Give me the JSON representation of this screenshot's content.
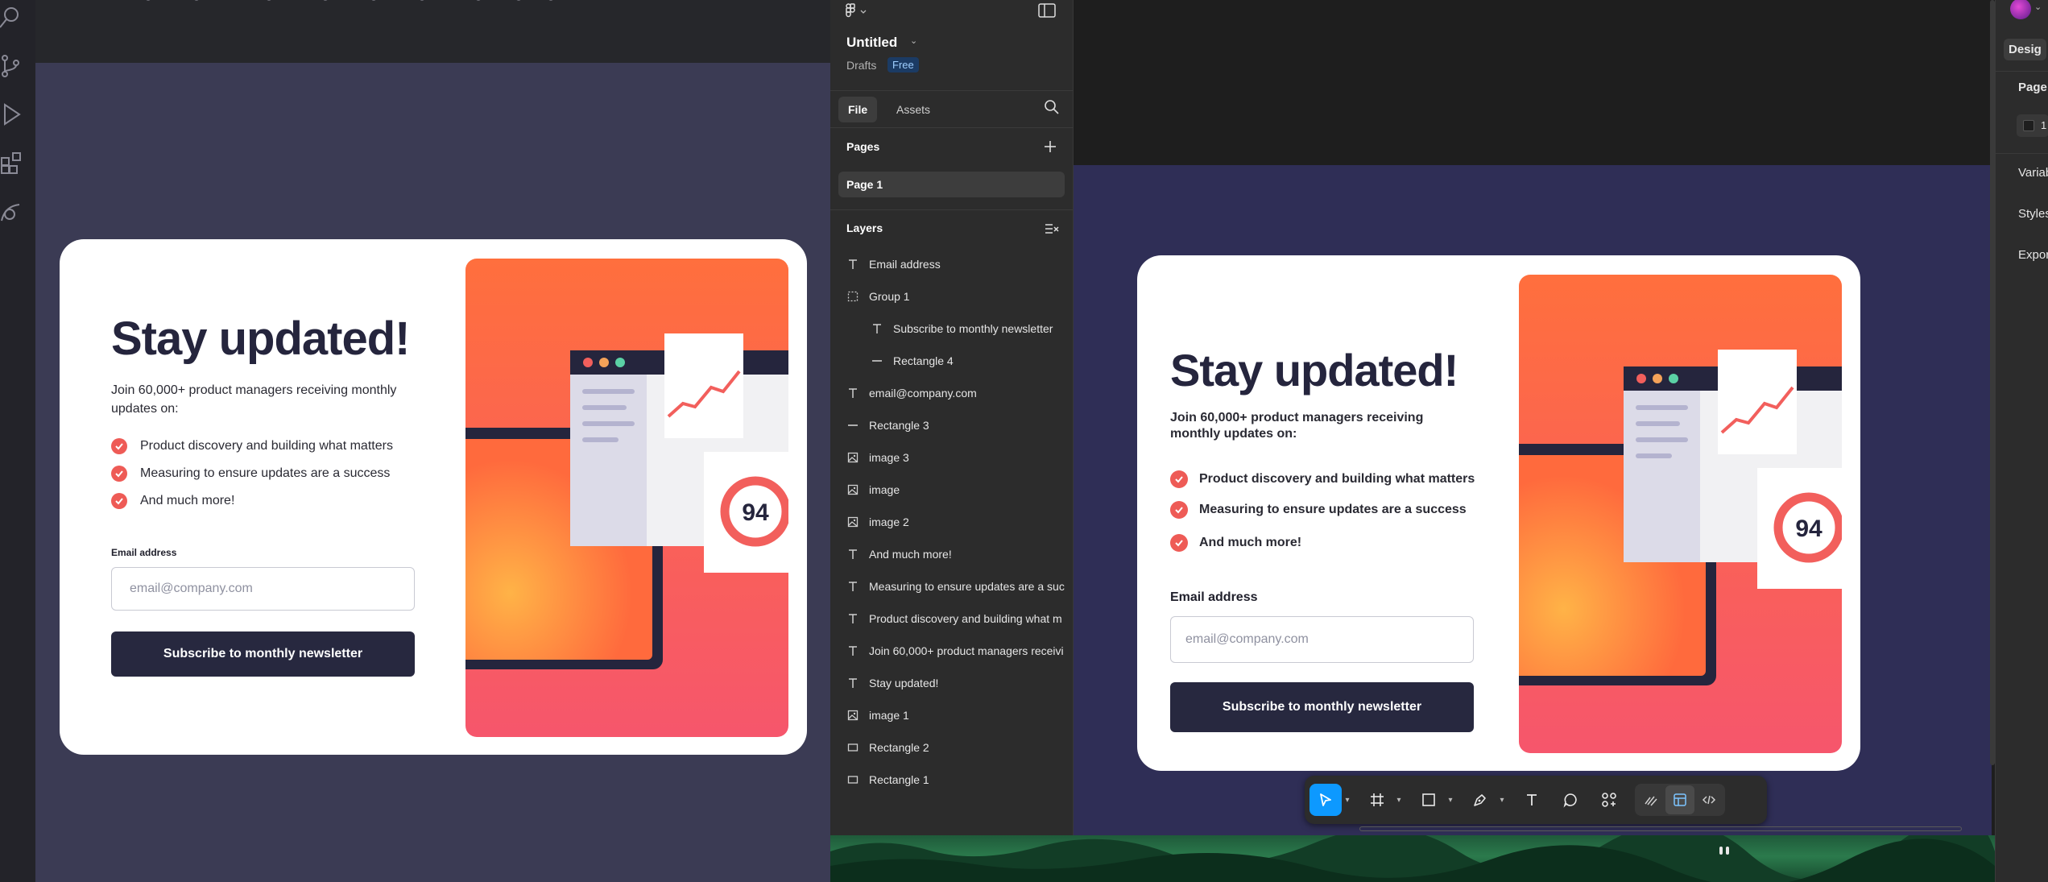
{
  "card": {
    "title": "Stay updated!",
    "intro": "Join 60,000+ product managers receiving monthly updates on:",
    "bullets": [
      "Product discovery and building what matters",
      "Measuring to ensure updates are a success",
      "And much more!"
    ],
    "email_label": "Email address",
    "email_placeholder": "email@company.com",
    "button": "Subscribe to monthly newsletter",
    "score": "94"
  },
  "panel": {
    "file_title": "Untitled",
    "drafts": "Drafts",
    "plan_badge": "Free",
    "tabs": [
      "File",
      "Assets"
    ],
    "pages_header": "Pages",
    "page_item": "Page 1",
    "layers_header": "Layers",
    "layers": [
      {
        "label": "Email address",
        "icon": "text-icon",
        "indent": false
      },
      {
        "label": "Group 1",
        "icon": "group-icon",
        "indent": false
      },
      {
        "label": "Subscribe to monthly newsletter",
        "icon": "text-icon",
        "indent": true
      },
      {
        "label": "Rectangle 4",
        "icon": "line-icon",
        "indent": true
      },
      {
        "label": "email@company.com",
        "icon": "text-icon",
        "indent": false
      },
      {
        "label": "Rectangle 3",
        "icon": "line-icon",
        "indent": false
      },
      {
        "label": "image 3",
        "icon": "image-icon",
        "indent": false
      },
      {
        "label": "image",
        "icon": "image-icon",
        "indent": false
      },
      {
        "label": "image 2",
        "icon": "image-icon",
        "indent": false
      },
      {
        "label": "And much more!",
        "icon": "text-icon",
        "indent": false
      },
      {
        "label": "Measuring to ensure updates are a suc",
        "icon": "text-icon",
        "indent": false
      },
      {
        "label": "Product discovery and building what m",
        "icon": "text-icon",
        "indent": false
      },
      {
        "label": "Join 60,000+ product managers receivi",
        "icon": "text-icon",
        "indent": false
      },
      {
        "label": "Stay updated!",
        "icon": "text-icon",
        "indent": false
      },
      {
        "label": "image 1",
        "icon": "image-icon",
        "indent": false
      },
      {
        "label": "Rectangle 2",
        "icon": "rectangle-icon",
        "indent": false
      },
      {
        "label": "Rectangle 1",
        "icon": "rectangle-icon",
        "indent": false
      }
    ]
  },
  "design_panel": {
    "tab": "Desig",
    "page_label": "Page",
    "page_value": "1",
    "variables": "Variab",
    "styles": "Styles",
    "export": "Expor"
  },
  "colors": {
    "accent": "#0d99ff",
    "brand_dark": "#27283f",
    "check_red": "#ee5b56",
    "hero_top": "#ff6f3d",
    "hero_bottom": "#f6566c"
  }
}
